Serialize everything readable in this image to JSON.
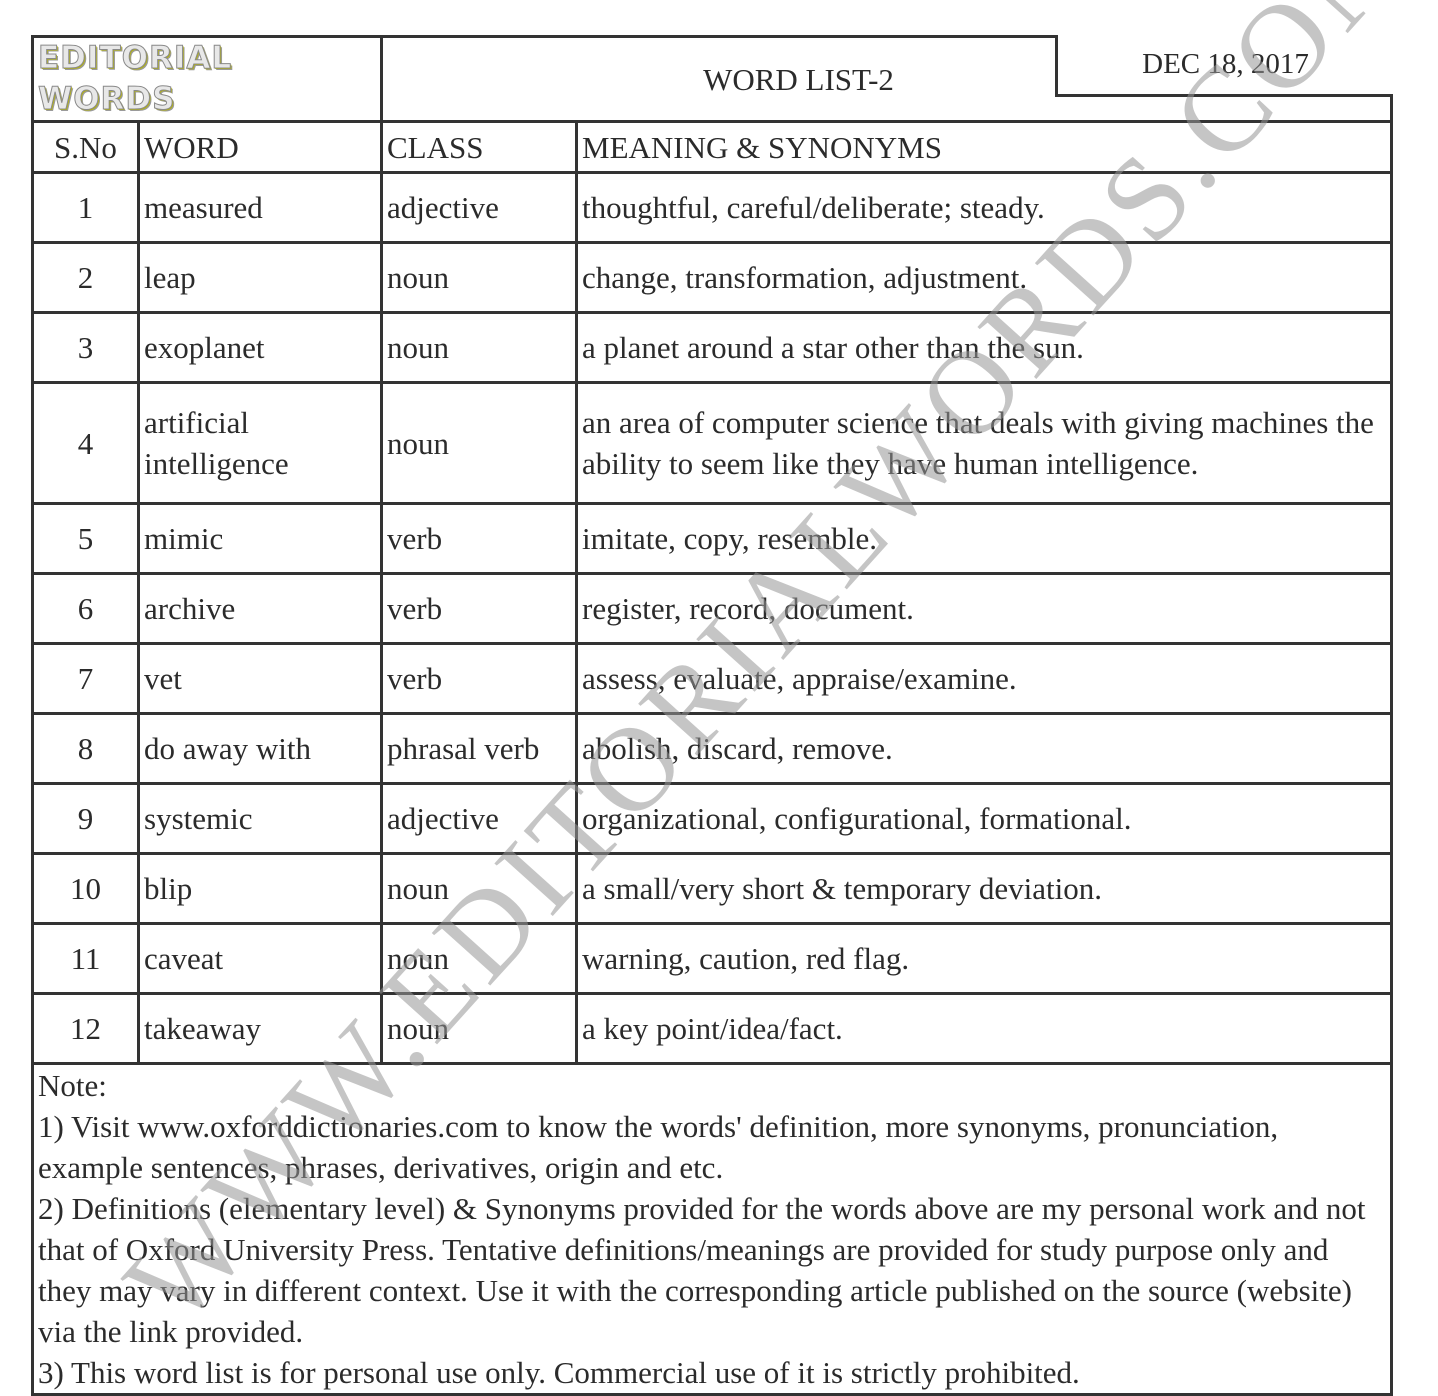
{
  "header": {
    "logo_text": "EDITORIAL WORDS",
    "title": "WORD LIST-2",
    "date": "DEC 18, 2017"
  },
  "columns": {
    "sno": "S.No",
    "word": "WORD",
    "class": "CLASS",
    "meaning": "MEANING & SYNONYMS"
  },
  "rows": [
    {
      "sno": "1",
      "word": "measured",
      "class": "adjective",
      "meaning": "thoughtful, careful/deliberate; steady."
    },
    {
      "sno": "2",
      "word": "leap",
      "class": "noun",
      "meaning": "change, transformation, adjustment."
    },
    {
      "sno": "3",
      "word": "exoplanet",
      "class": "noun",
      "meaning": "a planet around a star other than the sun."
    },
    {
      "sno": "4",
      "word": "artificial intelligence",
      "class": "noun",
      "meaning": "an area of computer science that deals with giving machines the ability to seem like they have human intelligence."
    },
    {
      "sno": "5",
      "word": "mimic",
      "class": "verb",
      "meaning": "imitate, copy, resemble."
    },
    {
      "sno": "6",
      "word": "archive",
      "class": "verb",
      "meaning": "register, record, document."
    },
    {
      "sno": "7",
      "word": "vet",
      "class": "verb",
      "meaning": "assess, evaluate, appraise/examine."
    },
    {
      "sno": "8",
      "word": "do away with",
      "class": "phrasal verb",
      "meaning": "abolish, discard, remove."
    },
    {
      "sno": "9",
      "word": "systemic",
      "class": "adjective",
      "meaning": "organizational, configurational, formational."
    },
    {
      "sno": "10",
      "word": "blip",
      "class": "noun",
      "meaning": "a small/very short & temporary deviation."
    },
    {
      "sno": "11",
      "word": "caveat",
      "class": "noun",
      "meaning": "warning, caution, red flag."
    },
    {
      "sno": "12",
      "word": "takeaway",
      "class": "noun",
      "meaning": "a key point/idea/fact."
    }
  ],
  "notes": {
    "label": "Note:",
    "items": [
      "1) Visit www.oxforddictionaries.com to know the words' definition, more synonyms, pronunciation, example sentences, phrases, derivatives, origin and etc.",
      "2) Definitions (elementary level) & Synonyms provided for the words above are my personal work and not that of Oxford University Press. Tentative definitions/meanings are provided for study purpose only and they may vary in different context. Use it with the corresponding article published on the source (website) via the link provided.",
      "3) This word list is for personal use only. Commercial use of it is strictly prohibited."
    ]
  },
  "watermark": "WWW.EDITORIALWORDS.COM"
}
